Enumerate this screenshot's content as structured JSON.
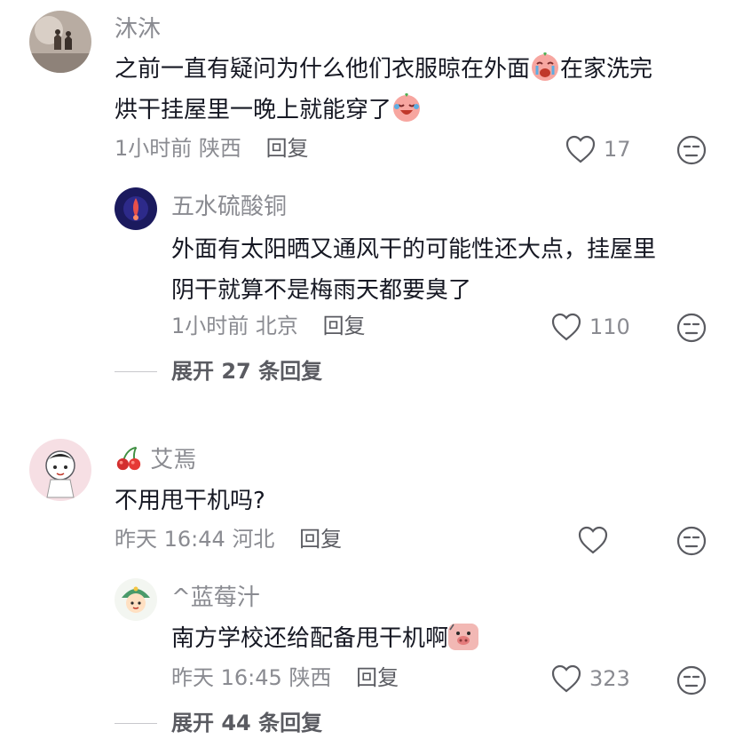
{
  "comments": [
    {
      "author": "沐沐",
      "text_line1_a": "之前一直有疑问为什么他们衣服晾在外面",
      "text_line1_b": "在家洗完",
      "text_line2": "烘干挂屋里一晚上就能穿了",
      "time": "1小时前",
      "location": "陕西",
      "reply_label": "回复",
      "likes": "17",
      "replies": [
        {
          "author": "五水硫酸铜",
          "text_line1": "外面有太阳晒又通风干的可能性还大点，挂屋里",
          "text_line2": "阴干就算不是梅雨天都要臭了",
          "time": "1小时前",
          "location": "北京",
          "reply_label": "回复",
          "likes": "110"
        }
      ],
      "expand_label": "展开 27 条回复"
    },
    {
      "author": "艾焉",
      "author_emoji": "cherry-icon",
      "text": "不用甩干机吗?",
      "time": "昨天 16:44",
      "location": "河北",
      "reply_label": "回复",
      "replies": [
        {
          "author": "^蓝莓汁",
          "text": "南方学校还给配备甩干机啊",
          "time": "昨天 16:45",
          "location": "陕西",
          "reply_label": "回复",
          "likes": "323"
        }
      ],
      "expand_label": "展开 44 条回复"
    }
  ]
}
